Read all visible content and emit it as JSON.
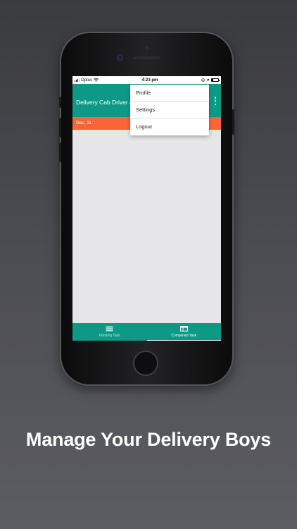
{
  "status_bar": {
    "carrier": "Optus",
    "time": "4:23 pm",
    "battery_level": 0.2
  },
  "app_bar": {
    "title": "Delivery Cab Driver App",
    "menu_icon": "more-vert-icon"
  },
  "date_bar": {
    "date": "Dec, 11"
  },
  "overflow_menu": {
    "items": [
      {
        "label": "Profile"
      },
      {
        "label": "Settings"
      },
      {
        "label": "Logout"
      }
    ]
  },
  "bottom_nav": {
    "tabs": [
      {
        "label": "Pending Task",
        "icon": "stack-icon",
        "active": false
      },
      {
        "label": "Completed Task",
        "icon": "calendar-icon",
        "active": true
      }
    ]
  },
  "tagline": "Manage Your Delivery Boys",
  "colors": {
    "primary": "#0e9986",
    "accent": "#fb6436",
    "background": "#e6e6e8"
  }
}
